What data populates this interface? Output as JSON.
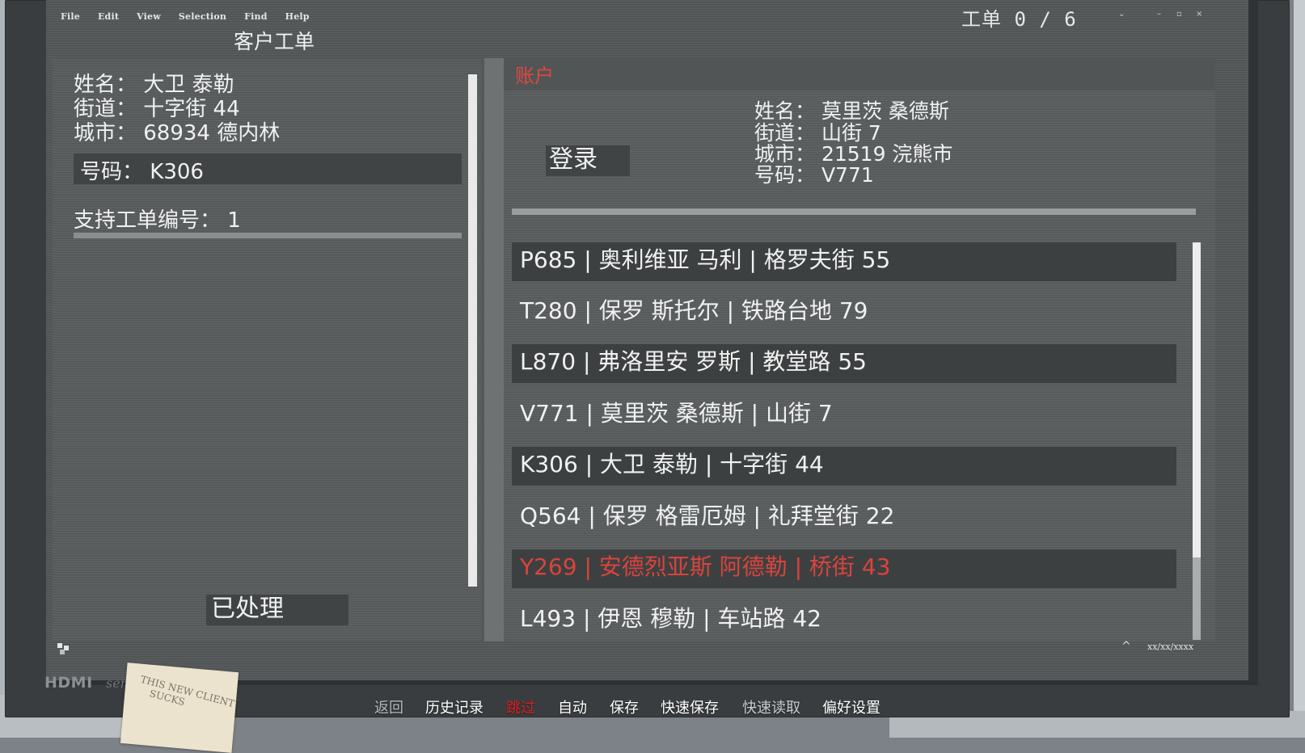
{
  "menu": [
    "File",
    "Edit",
    "View",
    "Selection",
    "Find",
    "Help"
  ],
  "header": {
    "title": "客户工单",
    "ticket_count": "工单 0 / 6"
  },
  "window_controls": {
    "dropdown": "⌄",
    "minimize": "–",
    "restore": "▫",
    "close": "×"
  },
  "customer": {
    "name": "姓名： 大卫 泰勒",
    "street": "街道： 十字街 44",
    "city": "城市： 68934 德内林",
    "id": "号码： K306",
    "support_ticket": "支持工单编号： 1",
    "processed_button": "已处理"
  },
  "account": {
    "label": "账户",
    "login_button": "登录",
    "name": "姓名： 莫里茨 桑德斯",
    "street": "街道： 山街 7",
    "city": "城市： 21519 浣熊市",
    "id": "号码： V771"
  },
  "accounts_list": [
    {
      "text": "P685 | 奥利维亚 马利 | 格罗夫街 55"
    },
    {
      "text": "T280 | 保罗 斯托尔 | 铁路台地 79"
    },
    {
      "text": "L870 | 弗洛里安 罗斯 | 教堂路 55"
    },
    {
      "text": "V771 | 莫里茨 桑德斯 | 山街 7"
    },
    {
      "text": "K306 | 大卫 泰勒 | 十字街 44"
    },
    {
      "text": "Q564 | 保罗 格雷厄姆 | 礼拜堂街 22"
    },
    {
      "text": "Y269 | 安德烈亚斯 阿德勒 | 桥街 43"
    },
    {
      "text": "L493 | 伊恩 穆勒 | 车站路 42"
    }
  ],
  "status_bar": {
    "date": "xx/xx/xxxx",
    "caret": "^"
  },
  "bezel": {
    "brand": "HDMI",
    "brand_sub": "sen",
    "sticky_note": "THIS NEW CLIENT\n    SUCKS"
  },
  "bottom_menu": {
    "back": "返回",
    "history": "历史记录",
    "skip": "跳过",
    "auto": "自动",
    "save": "保存",
    "quick_save": "快速保存",
    "quick_load": "快速读取",
    "preferences": "偏好设置"
  },
  "colors": {
    "accent_red": "#e0473f",
    "skip_red": "#e11d1d",
    "screen_bg": "#545859"
  }
}
